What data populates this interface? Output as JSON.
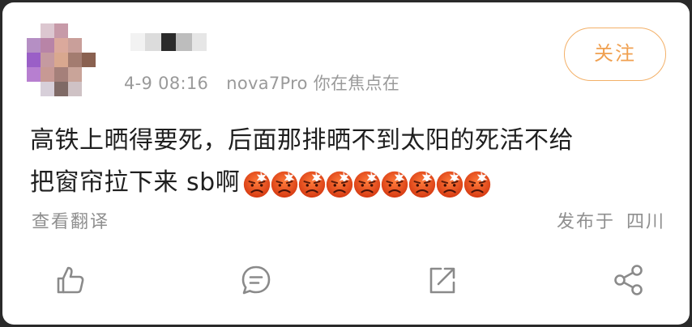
{
  "post": {
    "username_pixels": [
      "#f2f2f2",
      "#dcdcdc",
      "#2b2b2b",
      "#bdbdbd",
      "#e6e6e6"
    ],
    "date": "4-9 08:16",
    "device": "nova7Pro 你在焦点在",
    "follow_label": "关注",
    "content_line1": "高铁上晒得要死，后面那排晒不到太阳的死活不给",
    "content_line2": "把窗帘拉下来  sb啊",
    "emoji_count": 9,
    "emoji_name": "angry-face-icon",
    "translate_label": "查看翻译",
    "published_label": "发布于",
    "location": "四川"
  },
  "actions": [
    {
      "name": "like-button",
      "icon": "thumbs-up-icon"
    },
    {
      "name": "comment-button",
      "icon": "comment-icon"
    },
    {
      "name": "repost-button",
      "icon": "repost-icon"
    },
    {
      "name": "share-button",
      "icon": "share-icon"
    }
  ],
  "avatar_pixels": [
    [
      "#ffffff",
      "#dcc7d0",
      "#c79aa8",
      "#ffffff",
      "#ffffff"
    ],
    [
      "#b58fc4",
      "#b884a7",
      "#dba99c",
      "#c99f9a",
      "#ffffff"
    ],
    [
      "#9a5fc7",
      "#c59aa0",
      "#d9a88f",
      "#a37c70",
      "#8a6150"
    ],
    [
      "#b77fd0",
      "#c79994",
      "#a5807a",
      "#c9a499",
      "#ffffff"
    ],
    [
      "#ffffff",
      "#d7cfd9",
      "#7f6a66",
      "#cfc2c5",
      "#ffffff"
    ]
  ],
  "colors": {
    "accent": "#f0a050",
    "text": "#1f1f1f",
    "meta": "#9a9a9a"
  }
}
